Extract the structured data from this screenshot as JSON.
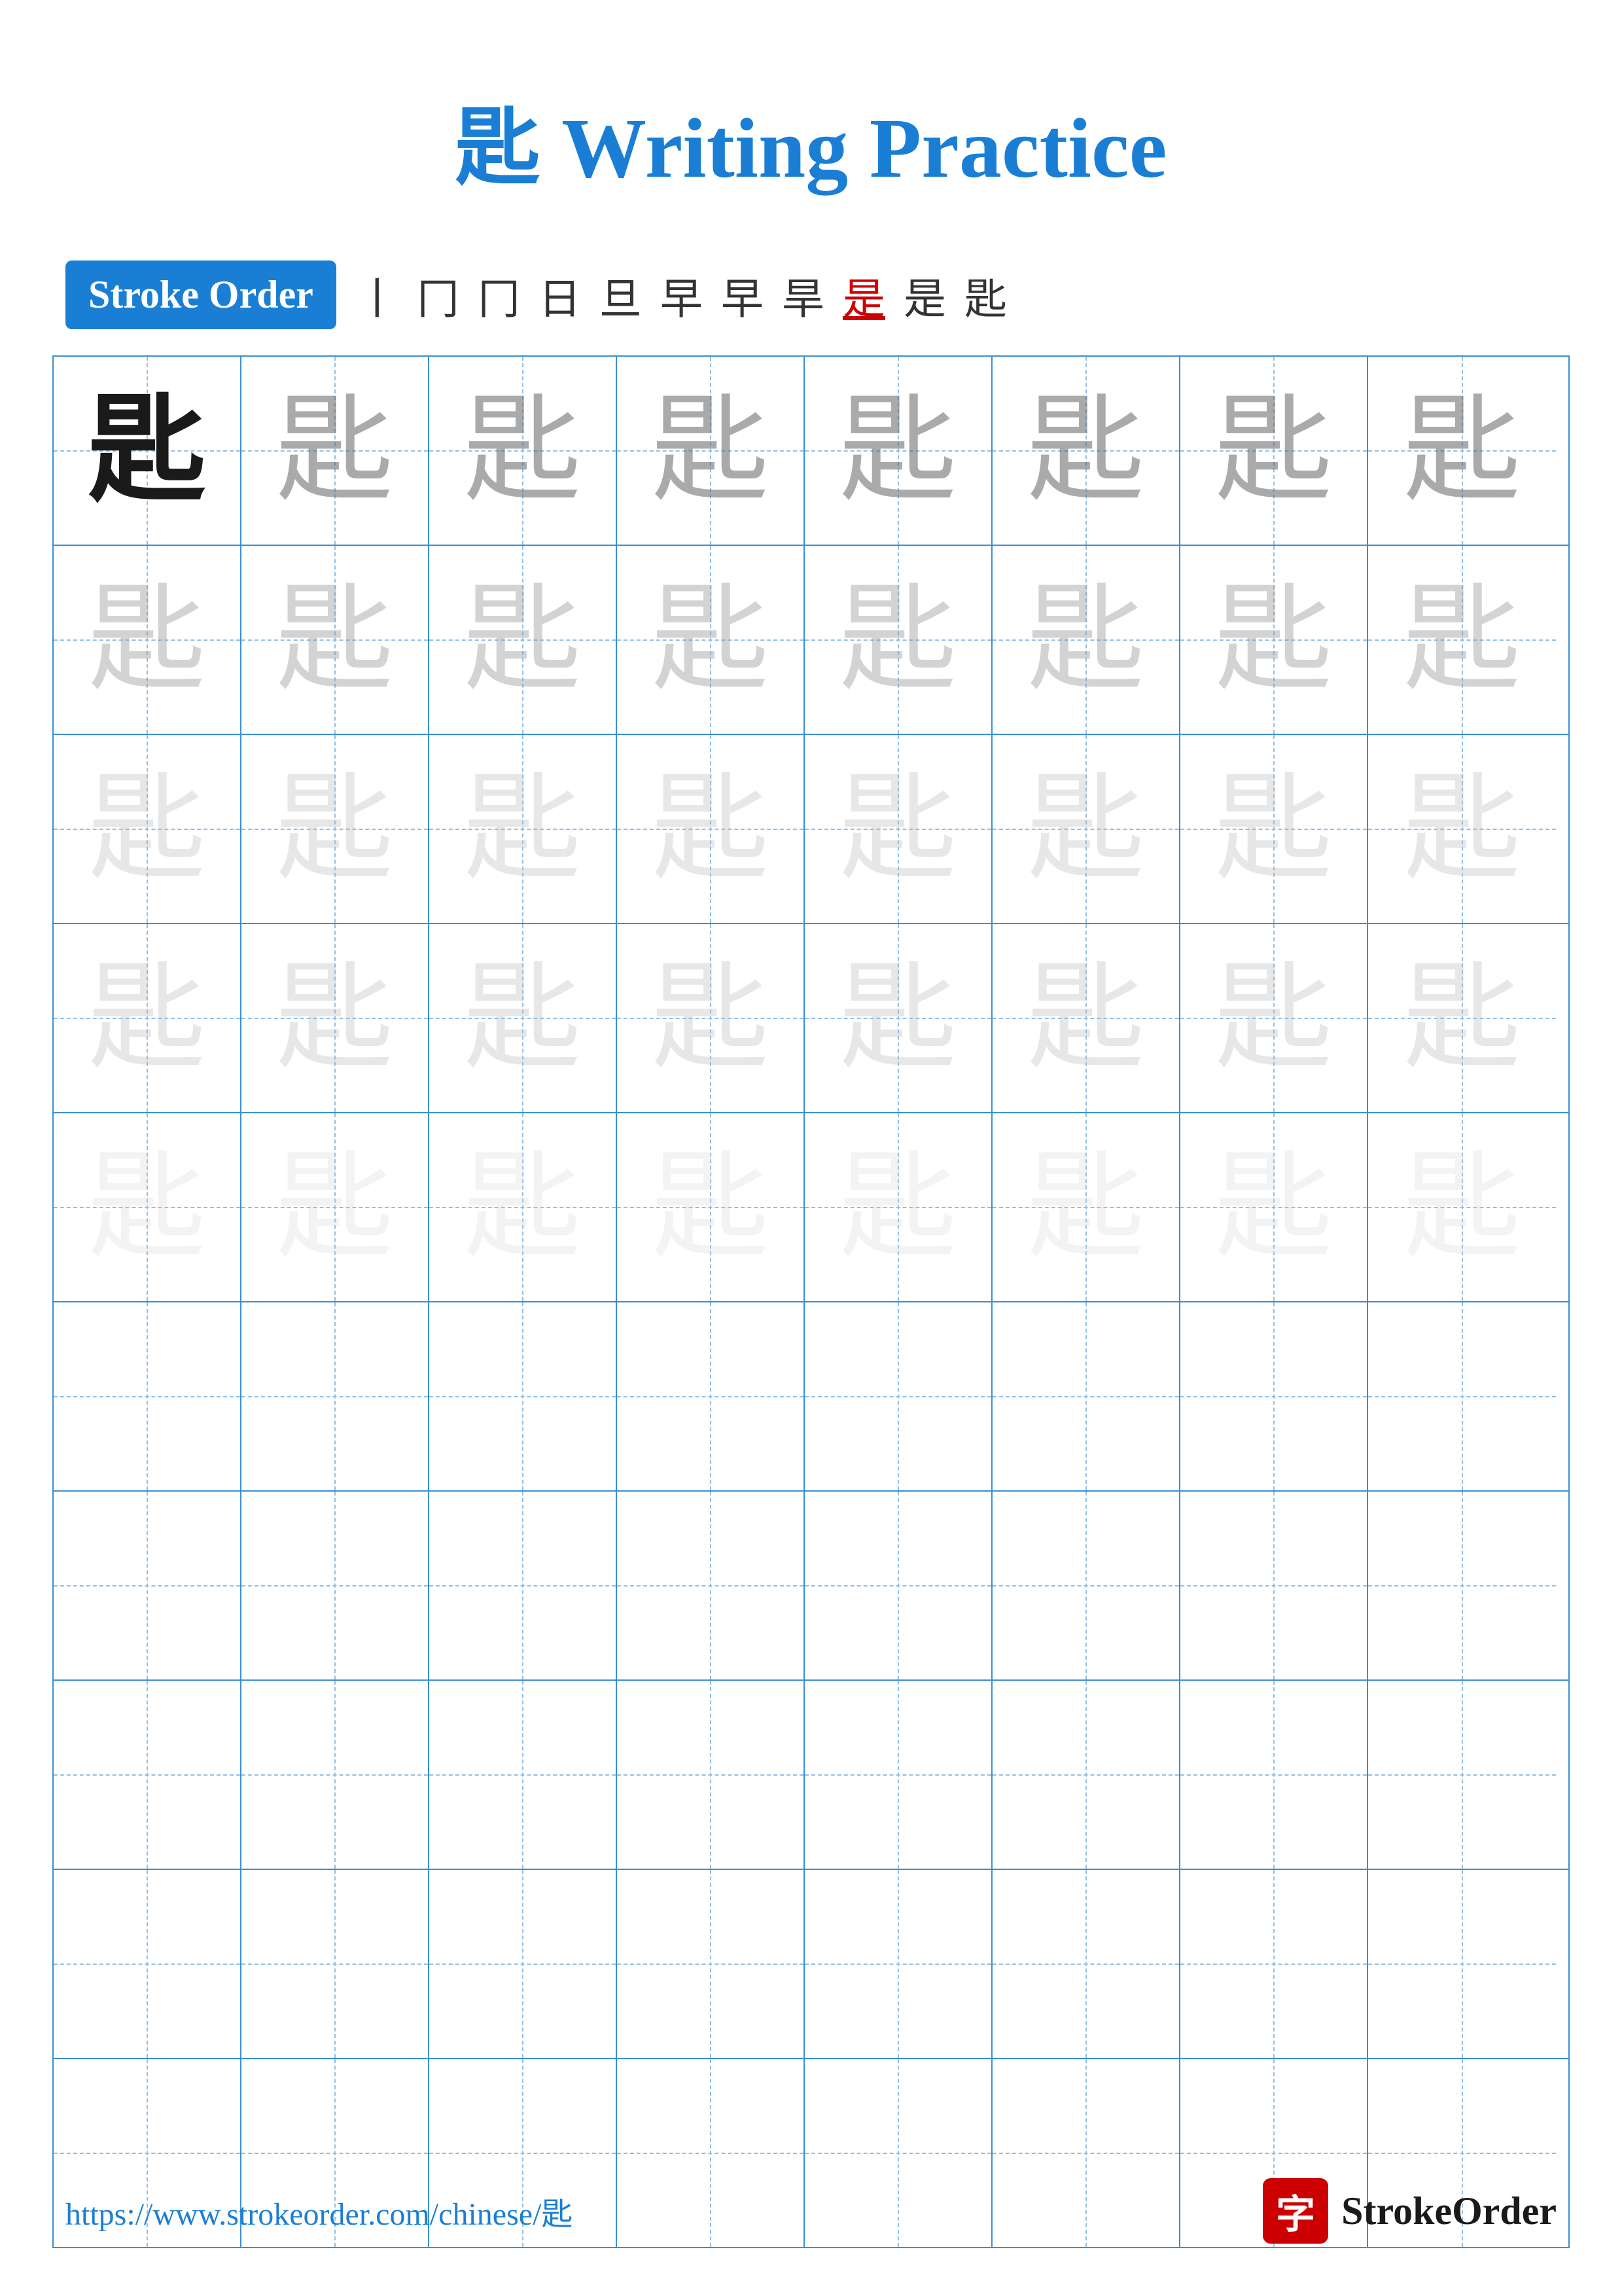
{
  "title": {
    "char": "匙",
    "text": " Writing Practice",
    "full": "匙 Writing Practice"
  },
  "stroke_order": {
    "badge_label": "Stroke Order",
    "steps": [
      "丨",
      "冂",
      "冂",
      "日",
      "旦",
      "早",
      "早",
      "旱",
      "是",
      "是",
      "匙"
    ]
  },
  "grid": {
    "rows": 10,
    "cols": 8,
    "char": "匙",
    "practice_rows": 5,
    "empty_rows": 5
  },
  "footer": {
    "url": "https://www.strokeorder.com/chinese/匙",
    "brand_char": "字",
    "brand_name": "StrokeOrder"
  }
}
